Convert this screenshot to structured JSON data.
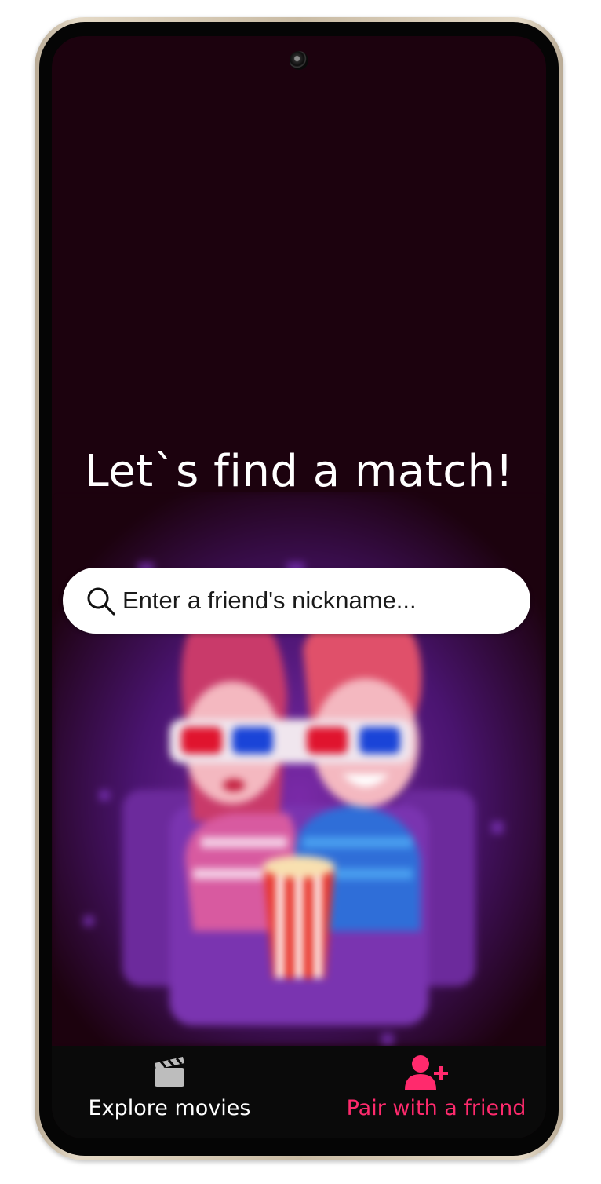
{
  "main": {
    "title": "Let`s find a match!",
    "search": {
      "placeholder": "Enter a friend's nickname..."
    }
  },
  "tabbar": {
    "items": [
      {
        "label": "Explore movies",
        "icon": "clapperboard-icon",
        "active": false
      },
      {
        "label": "Pair with a friend",
        "icon": "add-friend-icon",
        "active": true
      }
    ]
  },
  "colors": {
    "background": "#1c020e",
    "accent": "#ff2a6d",
    "tabbar": "#0a0a0a"
  }
}
